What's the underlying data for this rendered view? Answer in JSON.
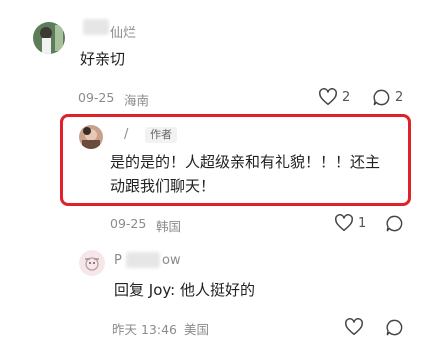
{
  "comments": [
    {
      "username": "仙烂",
      "text": "好亲切",
      "date": "09-25",
      "location": "海南",
      "like_count": "2",
      "reply_count": "2"
    },
    {
      "username": "/",
      "badge": "作者",
      "text_line1": "是的是的！人超级亲和有礼貌！！！还主",
      "text_line2": "动跟我们聊天！",
      "date": "09-25",
      "location": "韩国",
      "like_count": "1"
    },
    {
      "username_start": "P",
      "username_end": "ow",
      "text": "回复 Joy: 他人挺好的",
      "date": "昨天 13:46",
      "location": "美国"
    }
  ],
  "colors": {
    "highlight_border": "#e0202a",
    "meta_text": "#8c8c8c"
  },
  "icons": [
    "heart-icon",
    "comment-icon",
    "avatar-icon"
  ]
}
